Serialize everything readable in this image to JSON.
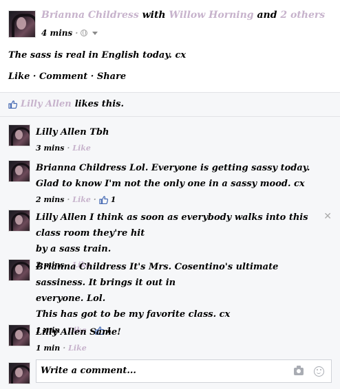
{
  "post": {
    "author": "Brianna Childress",
    "with_word": "with",
    "tagged": "Willow Horning",
    "and_word": "and",
    "others": "2 others",
    "time": "4 mins",
    "separator": "·",
    "text": "The sass is real in English today. cx",
    "actions": {
      "like": "Like",
      "comment": "Comment",
      "share": "Share",
      "separator": "·"
    }
  },
  "likes": {
    "name": "Lilly Allen",
    "suffix": "likes this."
  },
  "comments": [
    {
      "author": "Lilly Allen",
      "text": "Tbh",
      "time": "3 mins",
      "like": "Like",
      "likes": ""
    },
    {
      "author": "Brianna Childress",
      "text": "Lol. Everyone is getting sassy today.",
      "text2": "Glad to know I'm not the only one in a sassy mood. cx",
      "time": "2 mins",
      "like": "Like",
      "likes": "1"
    },
    {
      "author": "Lilly Allen",
      "text": "I think as soon as everybody walks into this class room they're hit",
      "text2": "by a sass train.",
      "time": "2 mins",
      "like": "Like",
      "likes": "",
      "close": "✕"
    },
    {
      "author": "Brianna Childress",
      "text": "It's Mrs. Cosentino's ultimate sassiness. It brings it out in",
      "text2": "everyone. Lol.",
      "text3": "This has got to be my favorite class. cx",
      "time": "1 min",
      "like": "Like",
      "likes": "1"
    },
    {
      "author": "Lilly Allen",
      "text": "Same!",
      "time": "1 min",
      "like": "Like",
      "likes": ""
    }
  ],
  "reply": {
    "placeholder": "Write a comment..."
  },
  "icons": {
    "post_audience": "globe-icon",
    "audience_menu": "chevron-down-icon",
    "like": "thumbs-up-icon",
    "camera": "camera-icon",
    "emoji": "emoji-icon",
    "close": "close-icon"
  },
  "colors": {
    "link": "#c7b3cc",
    "muted": "#9a9a9a",
    "like_blue": "#4267b2",
    "feedback_bg": "#f6f7f9"
  }
}
